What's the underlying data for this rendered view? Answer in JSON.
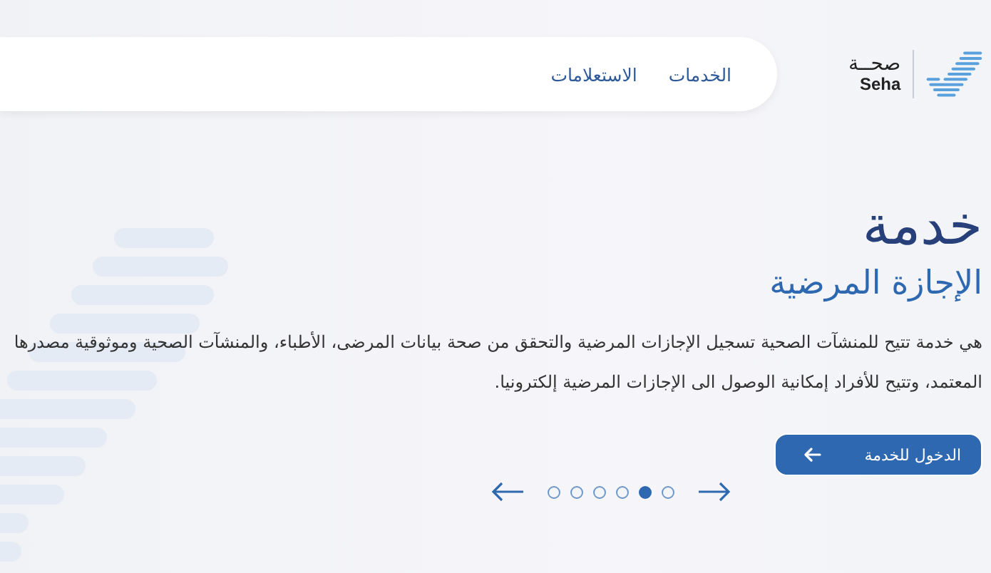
{
  "header": {
    "logo": {
      "arabic": "صحــة",
      "latin": "Seha"
    },
    "nav": [
      {
        "label": "الخدمات"
      },
      {
        "label": "الاستعلامات"
      }
    ]
  },
  "hero": {
    "title": "خدمة",
    "subtitle": "الإجازة المرضية",
    "description": "هي خدمة تتيح للمنشآت الصحية تسجيل الإجازات المرضية والتحقق من صحة بيانات المرضى، الأطباء، والمنشآت الصحية وموثوقية مصدرها المعتمد، وتتيح للأفراد إمكانية الوصول الى الإجازات المرضية إلكترونيا.",
    "button": {
      "label": "الدخول للخدمة"
    }
  },
  "carousel": {
    "dots": [
      {
        "selected": false
      },
      {
        "selected": true
      },
      {
        "selected": false
      },
      {
        "selected": false
      },
      {
        "selected": false
      },
      {
        "selected": false
      }
    ]
  }
}
